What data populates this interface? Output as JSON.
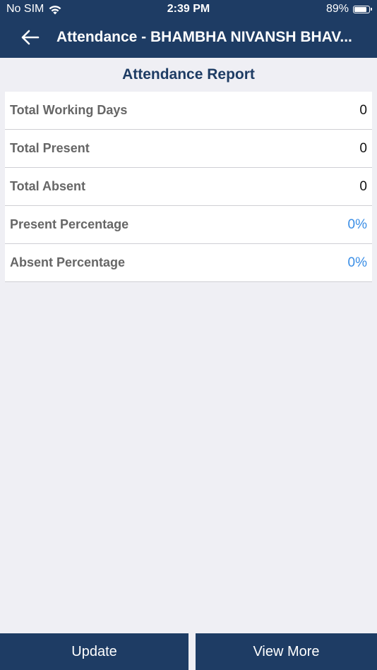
{
  "status_bar": {
    "carrier": "No SIM",
    "time": "2:39 PM",
    "battery_percent": "89%",
    "battery_level": 0.89,
    "icons": [
      "wifi-icon",
      "battery-icon"
    ]
  },
  "nav": {
    "back_icon": "arrow-left-icon",
    "title": "Attendance - BHAMBHA NIVANSH BHAV..."
  },
  "report": {
    "title": "Attendance Report",
    "rows": [
      {
        "label": "Total Working Days",
        "value": "0"
      },
      {
        "label": "Total Present",
        "value": "0"
      },
      {
        "label": "Total Absent",
        "value": "0"
      },
      {
        "label": "Present Percentage",
        "value": "0%"
      },
      {
        "label": "Absent Percentage",
        "value": "0%"
      }
    ]
  },
  "actions": {
    "update_label": "Update",
    "view_more_label": "View More"
  },
  "colors": {
    "primary": "#1e3c64",
    "background": "#efeff4",
    "accent_value": "#3a8ee6",
    "label_text": "#666666"
  }
}
